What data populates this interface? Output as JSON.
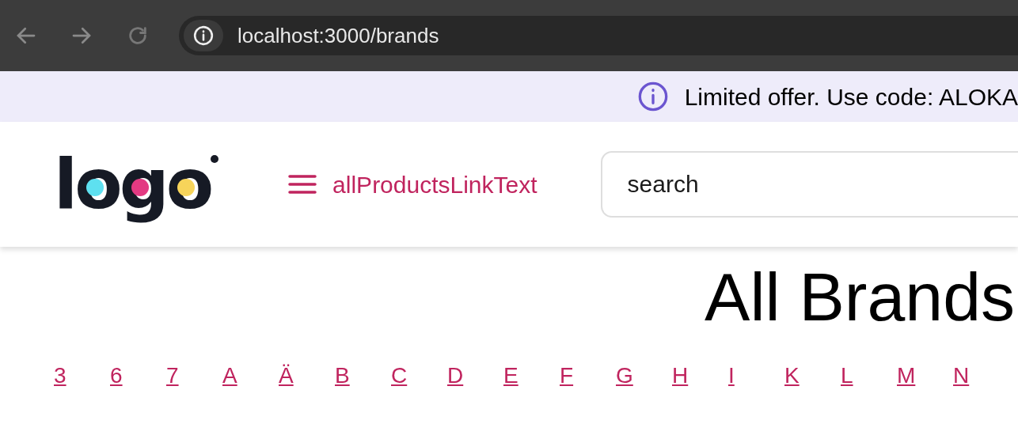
{
  "browser": {
    "url": "localhost:3000/brands"
  },
  "banner": {
    "text": "Limited offer. Use code: ALOKA"
  },
  "header": {
    "logo": "logo",
    "menu_link": "allProductsLinkText",
    "search": {
      "placeholder": "search"
    }
  },
  "page": {
    "title": "All Brands",
    "letters": [
      "3",
      "6",
      "7",
      "A",
      "Ä",
      "B",
      "C",
      "D",
      "E",
      "F",
      "G",
      "H",
      "I",
      "K",
      "L",
      "M",
      "N"
    ]
  }
}
